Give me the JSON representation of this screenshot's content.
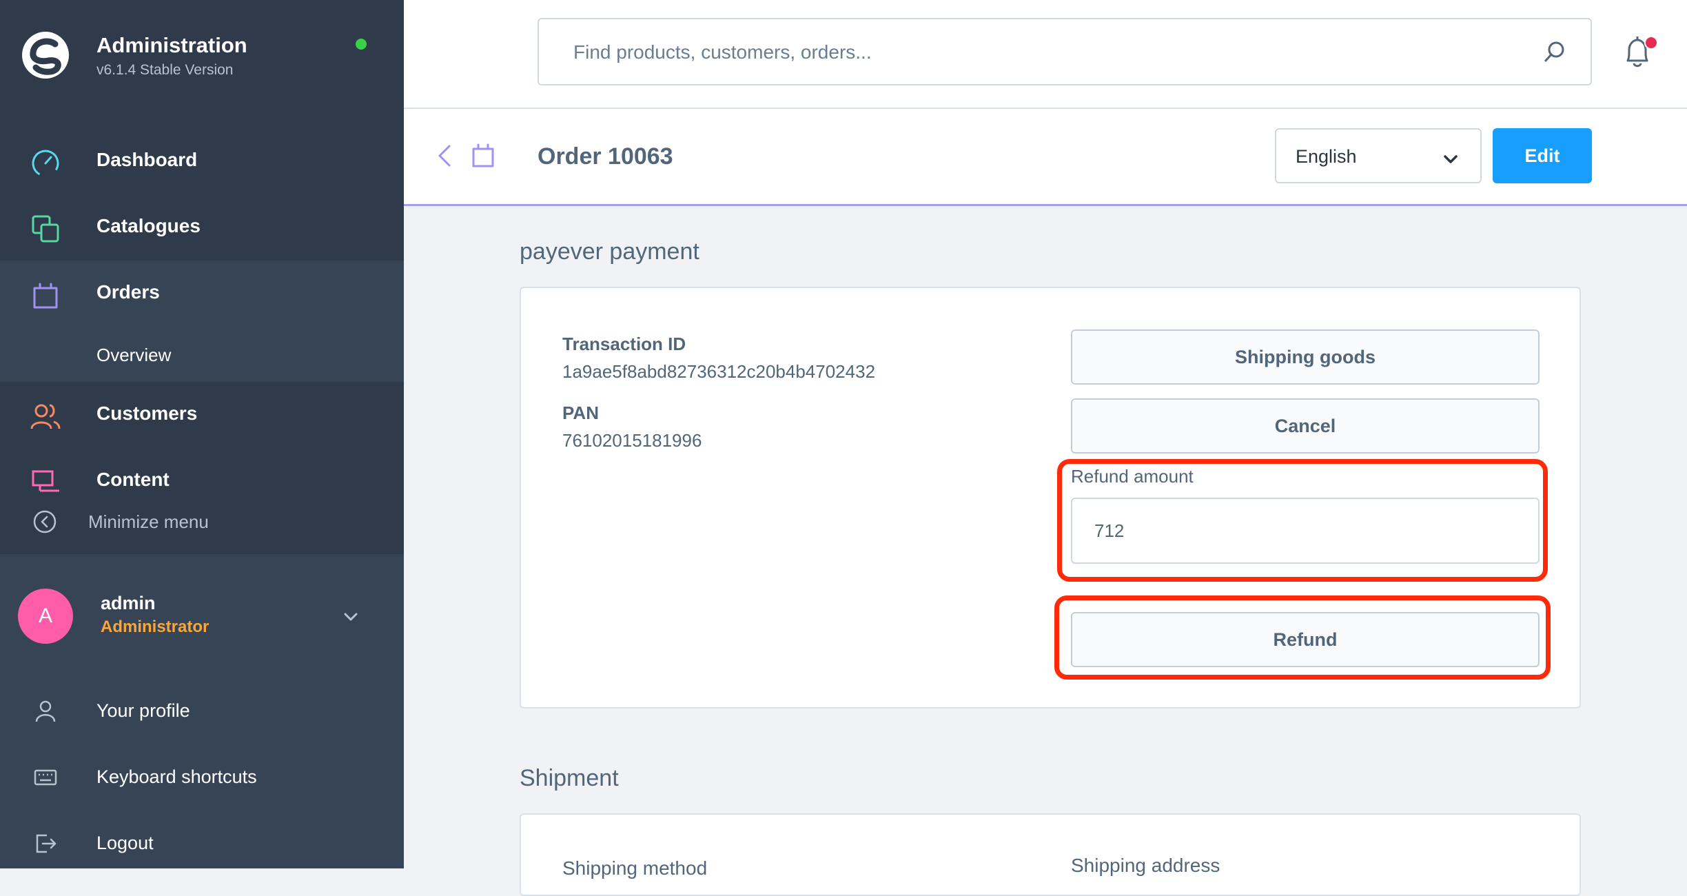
{
  "brand": {
    "title": "Administration",
    "version": "v6.1.4 Stable Version"
  },
  "nav": {
    "items": [
      {
        "label": "Dashboard",
        "icon": "dashboard-icon",
        "color": "#57d9f2"
      },
      {
        "label": "Catalogues",
        "icon": "catalogues-icon",
        "color": "#57d9a3"
      },
      {
        "label": "Orders",
        "icon": "orders-icon",
        "color": "#a092f0"
      },
      {
        "label": "Customers",
        "icon": "customers-icon",
        "color": "#f88962"
      },
      {
        "label": "Content",
        "icon": "content-icon",
        "color": "#ff68b4"
      }
    ],
    "orders_sub": "Overview",
    "minimize": "Minimize menu"
  },
  "user": {
    "initial": "A",
    "name": "admin",
    "role": "Administrator",
    "links": [
      {
        "label": "Your profile",
        "icon": "profile-icon"
      },
      {
        "label": "Keyboard shortcuts",
        "icon": "keyboard-icon"
      },
      {
        "label": "Logout",
        "icon": "logout-icon"
      }
    ]
  },
  "search": {
    "placeholder": "Find products, customers, orders..."
  },
  "header": {
    "title": "Order 10063",
    "language": "English",
    "edit_label": "Edit"
  },
  "payment": {
    "section_title": "payever payment",
    "transaction_label": "Transaction ID",
    "transaction_value": "1a9ae5f8abd82736312c20b4b4702432",
    "pan_label": "PAN",
    "pan_value": "76102015181996",
    "shipping_goods_label": "Shipping goods",
    "cancel_label": "Cancel",
    "refund_amount_label": "Refund amount",
    "refund_amount_value": "712",
    "refund_label": "Refund"
  },
  "shipment": {
    "section_title": "Shipment",
    "shipping_method_label": "Shipping method",
    "shipping_address_label": "Shipping address"
  },
  "colors": {
    "accent": "#189eff",
    "highlight": "#ff2a0a",
    "sidebar": "#2f3a4a"
  }
}
